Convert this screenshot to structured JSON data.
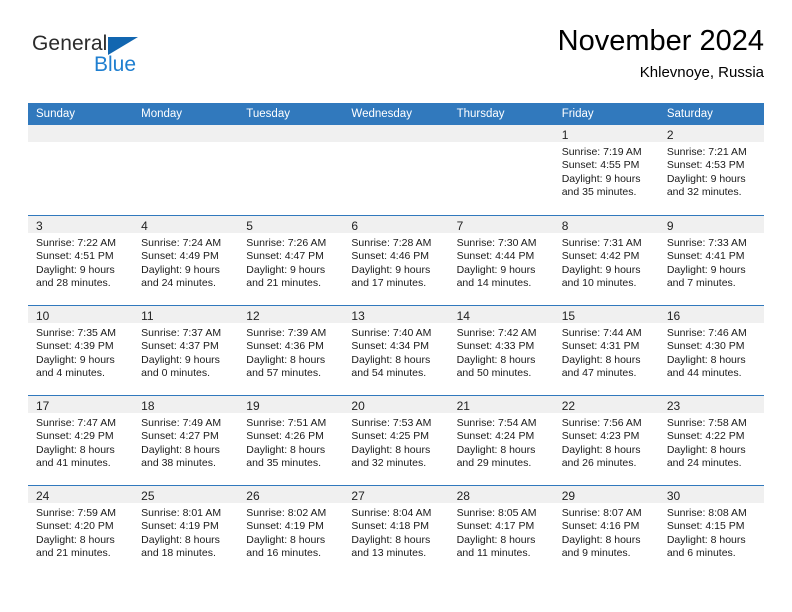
{
  "brand": {
    "word_one": "General",
    "word_two": "Blue",
    "triangle_icon": "brand-triangle-icon"
  },
  "header": {
    "month_title": "November 2024",
    "location": "Khlevnoye, Russia"
  },
  "colors": {
    "header_blue": "#3179bd",
    "brand_blue": "#1f7fd0",
    "daynum_band": "#f0f0f0",
    "text": "#000000"
  },
  "calendar": {
    "weekday_headers": [
      "Sunday",
      "Monday",
      "Tuesday",
      "Wednesday",
      "Thursday",
      "Friday",
      "Saturday"
    ],
    "weeks": [
      [
        {
          "day": "",
          "sunrise": "",
          "sunset": "",
          "daylight_line1": "",
          "daylight_line2": "",
          "empty": true
        },
        {
          "day": "",
          "sunrise": "",
          "sunset": "",
          "daylight_line1": "",
          "daylight_line2": "",
          "empty": true
        },
        {
          "day": "",
          "sunrise": "",
          "sunset": "",
          "daylight_line1": "",
          "daylight_line2": "",
          "empty": true
        },
        {
          "day": "",
          "sunrise": "",
          "sunset": "",
          "daylight_line1": "",
          "daylight_line2": "",
          "empty": true
        },
        {
          "day": "",
          "sunrise": "",
          "sunset": "",
          "daylight_line1": "",
          "daylight_line2": "",
          "empty": true
        },
        {
          "day": "1",
          "sunrise": "Sunrise: 7:19 AM",
          "sunset": "Sunset: 4:55 PM",
          "daylight_line1": "Daylight: 9 hours",
          "daylight_line2": "and 35 minutes."
        },
        {
          "day": "2",
          "sunrise": "Sunrise: 7:21 AM",
          "sunset": "Sunset: 4:53 PM",
          "daylight_line1": "Daylight: 9 hours",
          "daylight_line2": "and 32 minutes."
        }
      ],
      [
        {
          "day": "3",
          "sunrise": "Sunrise: 7:22 AM",
          "sunset": "Sunset: 4:51 PM",
          "daylight_line1": "Daylight: 9 hours",
          "daylight_line2": "and 28 minutes."
        },
        {
          "day": "4",
          "sunrise": "Sunrise: 7:24 AM",
          "sunset": "Sunset: 4:49 PM",
          "daylight_line1": "Daylight: 9 hours",
          "daylight_line2": "and 24 minutes."
        },
        {
          "day": "5",
          "sunrise": "Sunrise: 7:26 AM",
          "sunset": "Sunset: 4:47 PM",
          "daylight_line1": "Daylight: 9 hours",
          "daylight_line2": "and 21 minutes."
        },
        {
          "day": "6",
          "sunrise": "Sunrise: 7:28 AM",
          "sunset": "Sunset: 4:46 PM",
          "daylight_line1": "Daylight: 9 hours",
          "daylight_line2": "and 17 minutes."
        },
        {
          "day": "7",
          "sunrise": "Sunrise: 7:30 AM",
          "sunset": "Sunset: 4:44 PM",
          "daylight_line1": "Daylight: 9 hours",
          "daylight_line2": "and 14 minutes."
        },
        {
          "day": "8",
          "sunrise": "Sunrise: 7:31 AM",
          "sunset": "Sunset: 4:42 PM",
          "daylight_line1": "Daylight: 9 hours",
          "daylight_line2": "and 10 minutes."
        },
        {
          "day": "9",
          "sunrise": "Sunrise: 7:33 AM",
          "sunset": "Sunset: 4:41 PM",
          "daylight_line1": "Daylight: 9 hours",
          "daylight_line2": "and 7 minutes."
        }
      ],
      [
        {
          "day": "10",
          "sunrise": "Sunrise: 7:35 AM",
          "sunset": "Sunset: 4:39 PM",
          "daylight_line1": "Daylight: 9 hours",
          "daylight_line2": "and 4 minutes."
        },
        {
          "day": "11",
          "sunrise": "Sunrise: 7:37 AM",
          "sunset": "Sunset: 4:37 PM",
          "daylight_line1": "Daylight: 9 hours",
          "daylight_line2": "and 0 minutes."
        },
        {
          "day": "12",
          "sunrise": "Sunrise: 7:39 AM",
          "sunset": "Sunset: 4:36 PM",
          "daylight_line1": "Daylight: 8 hours",
          "daylight_line2": "and 57 minutes."
        },
        {
          "day": "13",
          "sunrise": "Sunrise: 7:40 AM",
          "sunset": "Sunset: 4:34 PM",
          "daylight_line1": "Daylight: 8 hours",
          "daylight_line2": "and 54 minutes."
        },
        {
          "day": "14",
          "sunrise": "Sunrise: 7:42 AM",
          "sunset": "Sunset: 4:33 PM",
          "daylight_line1": "Daylight: 8 hours",
          "daylight_line2": "and 50 minutes."
        },
        {
          "day": "15",
          "sunrise": "Sunrise: 7:44 AM",
          "sunset": "Sunset: 4:31 PM",
          "daylight_line1": "Daylight: 8 hours",
          "daylight_line2": "and 47 minutes."
        },
        {
          "day": "16",
          "sunrise": "Sunrise: 7:46 AM",
          "sunset": "Sunset: 4:30 PM",
          "daylight_line1": "Daylight: 8 hours",
          "daylight_line2": "and 44 minutes."
        }
      ],
      [
        {
          "day": "17",
          "sunrise": "Sunrise: 7:47 AM",
          "sunset": "Sunset: 4:29 PM",
          "daylight_line1": "Daylight: 8 hours",
          "daylight_line2": "and 41 minutes."
        },
        {
          "day": "18",
          "sunrise": "Sunrise: 7:49 AM",
          "sunset": "Sunset: 4:27 PM",
          "daylight_line1": "Daylight: 8 hours",
          "daylight_line2": "and 38 minutes."
        },
        {
          "day": "19",
          "sunrise": "Sunrise: 7:51 AM",
          "sunset": "Sunset: 4:26 PM",
          "daylight_line1": "Daylight: 8 hours",
          "daylight_line2": "and 35 minutes."
        },
        {
          "day": "20",
          "sunrise": "Sunrise: 7:53 AM",
          "sunset": "Sunset: 4:25 PM",
          "daylight_line1": "Daylight: 8 hours",
          "daylight_line2": "and 32 minutes."
        },
        {
          "day": "21",
          "sunrise": "Sunrise: 7:54 AM",
          "sunset": "Sunset: 4:24 PM",
          "daylight_line1": "Daylight: 8 hours",
          "daylight_line2": "and 29 minutes."
        },
        {
          "day": "22",
          "sunrise": "Sunrise: 7:56 AM",
          "sunset": "Sunset: 4:23 PM",
          "daylight_line1": "Daylight: 8 hours",
          "daylight_line2": "and 26 minutes."
        },
        {
          "day": "23",
          "sunrise": "Sunrise: 7:58 AM",
          "sunset": "Sunset: 4:22 PM",
          "daylight_line1": "Daylight: 8 hours",
          "daylight_line2": "and 24 minutes."
        }
      ],
      [
        {
          "day": "24",
          "sunrise": "Sunrise: 7:59 AM",
          "sunset": "Sunset: 4:20 PM",
          "daylight_line1": "Daylight: 8 hours",
          "daylight_line2": "and 21 minutes."
        },
        {
          "day": "25",
          "sunrise": "Sunrise: 8:01 AM",
          "sunset": "Sunset: 4:19 PM",
          "daylight_line1": "Daylight: 8 hours",
          "daylight_line2": "and 18 minutes."
        },
        {
          "day": "26",
          "sunrise": "Sunrise: 8:02 AM",
          "sunset": "Sunset: 4:19 PM",
          "daylight_line1": "Daylight: 8 hours",
          "daylight_line2": "and 16 minutes."
        },
        {
          "day": "27",
          "sunrise": "Sunrise: 8:04 AM",
          "sunset": "Sunset: 4:18 PM",
          "daylight_line1": "Daylight: 8 hours",
          "daylight_line2": "and 13 minutes."
        },
        {
          "day": "28",
          "sunrise": "Sunrise: 8:05 AM",
          "sunset": "Sunset: 4:17 PM",
          "daylight_line1": "Daylight: 8 hours",
          "daylight_line2": "and 11 minutes."
        },
        {
          "day": "29",
          "sunrise": "Sunrise: 8:07 AM",
          "sunset": "Sunset: 4:16 PM",
          "daylight_line1": "Daylight: 8 hours",
          "daylight_line2": "and 9 minutes."
        },
        {
          "day": "30",
          "sunrise": "Sunrise: 8:08 AM",
          "sunset": "Sunset: 4:15 PM",
          "daylight_line1": "Daylight: 8 hours",
          "daylight_line2": "and 6 minutes."
        }
      ]
    ]
  }
}
